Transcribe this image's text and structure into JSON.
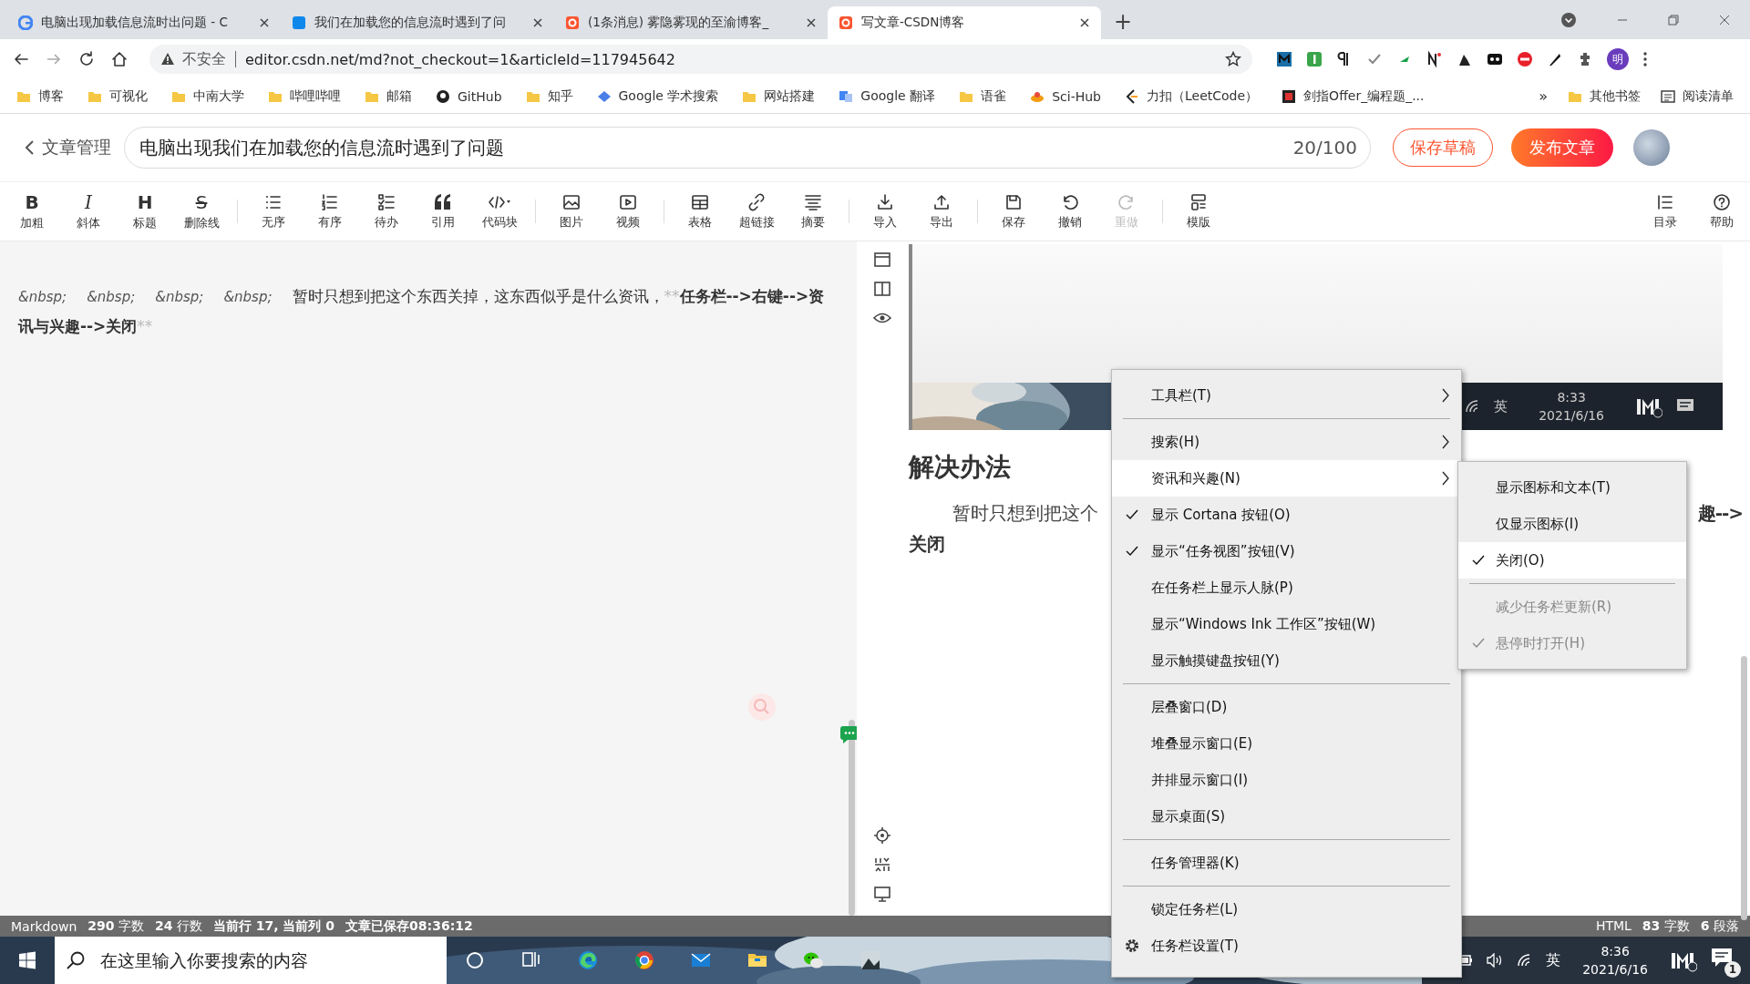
{
  "browser": {
    "tabs": [
      {
        "title": "电脑出现加载信息流时出问题 - C",
        "selected": false
      },
      {
        "title": "我们在加载您的信息流时遇到了问",
        "selected": false
      },
      {
        "title": "(1条消息) 雾隐雾现的至渝博客_",
        "selected": false
      },
      {
        "title": "写文章-CSDN博客",
        "selected": true
      }
    ],
    "new_tab": "+",
    "security_label": "不安全",
    "url": "editor.csdn.net/md?not_checkout=1&articleId=117945642",
    "profile_initial": "明",
    "bookmarks": [
      {
        "label": "博客",
        "kind": "folder"
      },
      {
        "label": "可视化",
        "kind": "folder"
      },
      {
        "label": "中南大学",
        "kind": "folder"
      },
      {
        "label": "哔哩哔哩",
        "kind": "folder"
      },
      {
        "label": "邮箱",
        "kind": "folder"
      },
      {
        "label": "GitHub",
        "kind": "site"
      },
      {
        "label": "知乎",
        "kind": "folder"
      },
      {
        "label": "Google 学术搜索",
        "kind": "site"
      },
      {
        "label": "网站搭建",
        "kind": "folder"
      },
      {
        "label": "Google 翻译",
        "kind": "site"
      },
      {
        "label": "语雀",
        "kind": "folder"
      },
      {
        "label": "Sci-Hub",
        "kind": "site"
      },
      {
        "label": "力扣（LeetCode）",
        "kind": "site"
      },
      {
        "label": "剑指Offer_编程题_...",
        "kind": "site"
      }
    ],
    "more_bookmarks": "»",
    "other_bookmarks": "其他书签",
    "reading_list": "阅读清单"
  },
  "editor_header": {
    "back_label": "文章管理",
    "title": "电脑出现我们在加载您的信息流时遇到了问题",
    "counter": "20/100",
    "save_draft": "保存草稿",
    "publish": "发布文章"
  },
  "toolbar": {
    "groups": [
      [
        {
          "label": "加粗",
          "glyph": "B",
          "disabled": false
        },
        {
          "label": "斜体",
          "glyph": "I",
          "disabled": false
        },
        {
          "label": "标题",
          "glyph": "H",
          "disabled": false
        },
        {
          "label": "删除线",
          "glyph": "S",
          "disabled": false
        }
      ],
      [
        {
          "label": "无序",
          "disabled": false
        },
        {
          "label": "有序",
          "disabled": false
        },
        {
          "label": "待办",
          "disabled": false
        },
        {
          "label": "引用",
          "disabled": false
        },
        {
          "label": "代码块",
          "disabled": false
        }
      ],
      [
        {
          "label": "图片",
          "disabled": false
        },
        {
          "label": "视频",
          "disabled": false
        }
      ],
      [
        {
          "label": "表格",
          "disabled": false
        },
        {
          "label": "超链接",
          "disabled": false
        },
        {
          "label": "摘要",
          "disabled": false
        }
      ],
      [
        {
          "label": "导入",
          "disabled": false
        },
        {
          "label": "导出",
          "disabled": false
        }
      ],
      [
        {
          "label": "保存",
          "disabled": false
        },
        {
          "label": "撤销",
          "disabled": false
        },
        {
          "label": "重做",
          "disabled": true
        }
      ],
      [
        {
          "label": "模版",
          "disabled": false
        }
      ]
    ],
    "right": [
      {
        "label": "目录",
        "disabled": false
      },
      {
        "label": "帮助",
        "disabled": false
      }
    ]
  },
  "editor": {
    "segments": [
      {
        "kind": "entity",
        "text": "&nbsp;"
      },
      {
        "kind": "entity",
        "text": "&nbsp;"
      },
      {
        "kind": "entity",
        "text": "&nbsp;"
      },
      {
        "kind": "entity",
        "text": "&nbsp;"
      },
      {
        "kind": "text",
        "text": "暂时只想到把这个东西关掉，这东西似乎是什么资讯，"
      },
      {
        "kind": "marker",
        "text": "**"
      },
      {
        "kind": "bold",
        "text": "任务栏-->右键-->资讯与兴趣-->关闭"
      },
      {
        "kind": "marker",
        "text": "**"
      }
    ]
  },
  "preview": {
    "image": {
      "kind": "picture",
      "ime": "英",
      "time": "8:33",
      "date": "2021/6/16"
    },
    "heading": "解决办法",
    "paragraph_start": "暂时只想到把这个",
    "paragraph_end": "趣-->",
    "paragraph_line_2": "关闭"
  },
  "status_bar": {
    "left": [
      "Markdown",
      "**290** 字数",
      "**24** 行数",
      "**当前行 17, 当前列 0**",
      "**文章已保存08:36:12**"
    ],
    "right": [
      "HTML",
      "**83** 字数",
      "**6** 段落"
    ]
  },
  "context_menu": {
    "items": [
      {
        "kind": "item",
        "label": "工具栏(T)",
        "checked": false,
        "submenu": true,
        "selected": false
      },
      {
        "kind": "separator"
      },
      {
        "kind": "item",
        "label": "搜索(H)",
        "checked": false,
        "submenu": true,
        "selected": false
      },
      {
        "kind": "item",
        "label": "资讯和兴趣(N)",
        "checked": false,
        "submenu": true,
        "selected": true
      },
      {
        "kind": "item",
        "label": "显示 Cortana 按钮(O)",
        "checked": true,
        "submenu": false,
        "selected": false
      },
      {
        "kind": "item",
        "label": "显示“任务视图”按钮(V)",
        "checked": true,
        "submenu": false,
        "selected": false
      },
      {
        "kind": "item",
        "label": "在任务栏上显示人脉(P)",
        "checked": false,
        "submenu": false,
        "selected": false
      },
      {
        "kind": "item",
        "label": "显示“Windows Ink 工作区”按钮(W)",
        "checked": false,
        "submenu": false,
        "selected": false
      },
      {
        "kind": "item",
        "label": "显示触摸键盘按钮(Y)",
        "checked": false,
        "submenu": false,
        "selected": false
      },
      {
        "kind": "separator"
      },
      {
        "kind": "item",
        "label": "层叠窗口(D)",
        "checked": false,
        "submenu": false,
        "selected": false
      },
      {
        "kind": "item",
        "label": "堆叠显示窗口(E)",
        "checked": false,
        "submenu": false,
        "selected": false
      },
      {
        "kind": "item",
        "label": "并排显示窗口(I)",
        "checked": false,
        "submenu": false,
        "selected": false
      },
      {
        "kind": "item",
        "label": "显示桌面(S)",
        "checked": false,
        "submenu": false,
        "selected": false
      },
      {
        "kind": "separator"
      },
      {
        "kind": "item",
        "label": "任务管理器(K)",
        "checked": false,
        "submenu": false,
        "selected": false
      },
      {
        "kind": "separator"
      },
      {
        "kind": "item",
        "label": "锁定任务栏(L)",
        "checked": false,
        "submenu": false,
        "selected": false
      },
      {
        "kind": "settings",
        "label": "任务栏设置(T)",
        "checked": false,
        "submenu": false,
        "selected": false
      }
    ]
  },
  "submenu": {
    "items": [
      {
        "kind": "item",
        "label": "显示图标和文本(T)",
        "checked": false,
        "selected": false,
        "disabled": false
      },
      {
        "kind": "item",
        "label": "仅显示图标(I)",
        "checked": false,
        "selected": false,
        "disabled": false
      },
      {
        "kind": "item",
        "label": "关闭(O)",
        "checked": true,
        "selected": true,
        "disabled": false
      },
      {
        "kind": "separator"
      },
      {
        "kind": "item",
        "label": "减少任务栏更新(R)",
        "checked": false,
        "selected": false,
        "disabled": true
      },
      {
        "kind": "item",
        "label": "悬停时打开(H)",
        "checked": true,
        "selected": false,
        "disabled": true
      }
    ]
  },
  "taskbar": {
    "search_placeholder": "在这里输入你要搜索的内容",
    "ime": "英",
    "time": "8:36",
    "date": "2021/6/16",
    "notification_count": "1"
  }
}
